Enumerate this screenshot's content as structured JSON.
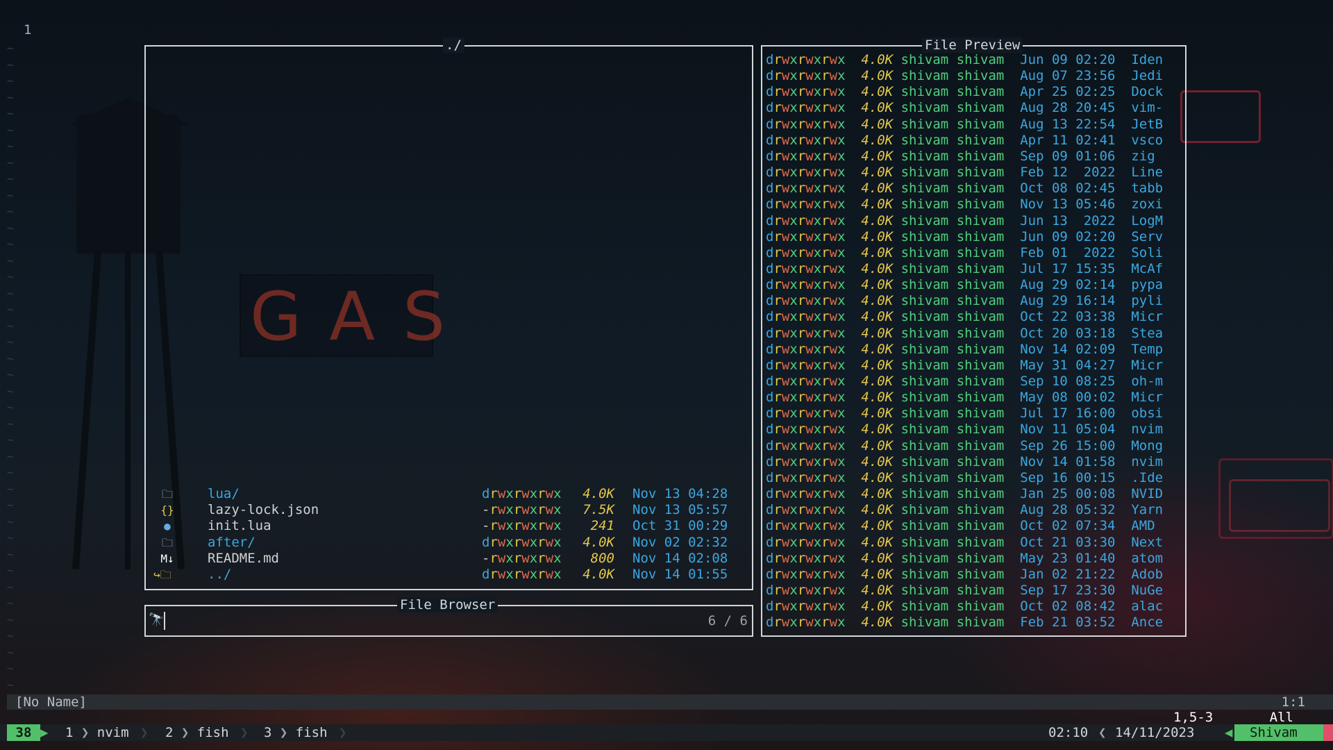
{
  "editor": {
    "line_number": "1",
    "buffer_name": "[No Name]",
    "cursor_pos": "1:1",
    "ruler_pos": "1,5-3",
    "ruler_scroll": "All"
  },
  "file_browser": {
    "path_title": "./",
    "title": "File Browser",
    "prompt_value": "",
    "count": "6 / 6",
    "entries": [
      {
        "icon": "folder-icon",
        "name": "lua/",
        "perm": "drwxrwxrwx",
        "size": "4.0K",
        "date": "Nov 13 04:28",
        "is_dir": true
      },
      {
        "icon": "json-icon",
        "name": "lazy-lock.json",
        "perm": "-rwxrwxrwx",
        "size": "7.5K",
        "date": "Nov 13 05:57",
        "is_dir": false
      },
      {
        "icon": "lua-icon",
        "name": "init.lua",
        "perm": "-rwxrwxrwx",
        "size": "241",
        "date": "Oct 31 00:29",
        "is_dir": false
      },
      {
        "icon": "folder-icon",
        "name": "after/",
        "perm": "drwxrwxrwx",
        "size": "4.0K",
        "date": "Nov 02 02:32",
        "is_dir": true
      },
      {
        "icon": "markdown-icon",
        "name": "README.md",
        "perm": "-rwxrwxrwx",
        "size": "800",
        "date": "Nov 14 02:08",
        "is_dir": false
      },
      {
        "icon": "parent-folder-icon",
        "name": "../",
        "perm": "drwxrwxrwx",
        "size": "4.0K",
        "date": "Nov 14 01:55",
        "is_dir": true
      }
    ]
  },
  "file_preview": {
    "title": "File Preview",
    "rows": [
      {
        "perm": "drwxrwxrwx",
        "size": "4.0K",
        "user": "shivam",
        "group": "shivam",
        "date": "Jun 09 02:20",
        "name": "Iden"
      },
      {
        "perm": "drwxrwxrwx",
        "size": "4.0K",
        "user": "shivam",
        "group": "shivam",
        "date": "Aug 07 23:56",
        "name": "Jedi"
      },
      {
        "perm": "drwxrwxrwx",
        "size": "4.0K",
        "user": "shivam",
        "group": "shivam",
        "date": "Apr 25 02:25",
        "name": "Dock"
      },
      {
        "perm": "drwxrwxrwx",
        "size": "4.0K",
        "user": "shivam",
        "group": "shivam",
        "date": "Aug 28 20:45",
        "name": "vim-"
      },
      {
        "perm": "drwxrwxrwx",
        "size": "4.0K",
        "user": "shivam",
        "group": "shivam",
        "date": "Aug 13 22:54",
        "name": "JetB"
      },
      {
        "perm": "drwxrwxrwx",
        "size": "4.0K",
        "user": "shivam",
        "group": "shivam",
        "date": "Apr 11 02:41",
        "name": "vsco"
      },
      {
        "perm": "drwxrwxrwx",
        "size": "4.0K",
        "user": "shivam",
        "group": "shivam",
        "date": "Sep 09 01:06",
        "name": "zig"
      },
      {
        "perm": "drwxrwxrwx",
        "size": "4.0K",
        "user": "shivam",
        "group": "shivam",
        "date": "Feb 12  2022",
        "name": "Line"
      },
      {
        "perm": "drwxrwxrwx",
        "size": "4.0K",
        "user": "shivam",
        "group": "shivam",
        "date": "Oct 08 02:45",
        "name": "tabb"
      },
      {
        "perm": "drwxrwxrwx",
        "size": "4.0K",
        "user": "shivam",
        "group": "shivam",
        "date": "Nov 13 05:46",
        "name": "zoxi"
      },
      {
        "perm": "drwxrwxrwx",
        "size": "4.0K",
        "user": "shivam",
        "group": "shivam",
        "date": "Jun 13  2022",
        "name": "LogM"
      },
      {
        "perm": "drwxrwxrwx",
        "size": "4.0K",
        "user": "shivam",
        "group": "shivam",
        "date": "Jun 09 02:20",
        "name": "Serv"
      },
      {
        "perm": "drwxrwxrwx",
        "size": "4.0K",
        "user": "shivam",
        "group": "shivam",
        "date": "Feb 01  2022",
        "name": "Soli"
      },
      {
        "perm": "drwxrwxrwx",
        "size": "4.0K",
        "user": "shivam",
        "group": "shivam",
        "date": "Jul 17 15:35",
        "name": "McAf"
      },
      {
        "perm": "drwxrwxrwx",
        "size": "4.0K",
        "user": "shivam",
        "group": "shivam",
        "date": "Aug 29 02:14",
        "name": "pypa"
      },
      {
        "perm": "drwxrwxrwx",
        "size": "4.0K",
        "user": "shivam",
        "group": "shivam",
        "date": "Aug 29 16:14",
        "name": "pyli"
      },
      {
        "perm": "drwxrwxrwx",
        "size": "4.0K",
        "user": "shivam",
        "group": "shivam",
        "date": "Oct 22 03:38",
        "name": "Micr"
      },
      {
        "perm": "drwxrwxrwx",
        "size": "4.0K",
        "user": "shivam",
        "group": "shivam",
        "date": "Oct 20 03:18",
        "name": "Stea"
      },
      {
        "perm": "drwxrwxrwx",
        "size": "4.0K",
        "user": "shivam",
        "group": "shivam",
        "date": "Nov 14 02:09",
        "name": "Temp"
      },
      {
        "perm": "drwxrwxrwx",
        "size": "4.0K",
        "user": "shivam",
        "group": "shivam",
        "date": "May 31 04:27",
        "name": "Micr"
      },
      {
        "perm": "drwxrwxrwx",
        "size": "4.0K",
        "user": "shivam",
        "group": "shivam",
        "date": "Sep 10 08:25",
        "name": "oh-m"
      },
      {
        "perm": "drwxrwxrwx",
        "size": "4.0K",
        "user": "shivam",
        "group": "shivam",
        "date": "May 08 00:02",
        "name": "Micr"
      },
      {
        "perm": "drwxrwxrwx",
        "size": "4.0K",
        "user": "shivam",
        "group": "shivam",
        "date": "Jul 17 16:00",
        "name": "obsi"
      },
      {
        "perm": "drwxrwxrwx",
        "size": "4.0K",
        "user": "shivam",
        "group": "shivam",
        "date": "Nov 11 05:04",
        "name": "nvim"
      },
      {
        "perm": "drwxrwxrwx",
        "size": "4.0K",
        "user": "shivam",
        "group": "shivam",
        "date": "Sep 26 15:00",
        "name": "Mong"
      },
      {
        "perm": "drwxrwxrwx",
        "size": "4.0K",
        "user": "shivam",
        "group": "shivam",
        "date": "Nov 14 01:58",
        "name": "nvim"
      },
      {
        "perm": "drwxrwxrwx",
        "size": "4.0K",
        "user": "shivam",
        "group": "shivam",
        "date": "Sep 16 00:15",
        "name": ".Ide"
      },
      {
        "perm": "drwxrwxrwx",
        "size": "4.0K",
        "user": "shivam",
        "group": "shivam",
        "date": "Jan 25 00:08",
        "name": "NVID"
      },
      {
        "perm": "drwxrwxrwx",
        "size": "4.0K",
        "user": "shivam",
        "group": "shivam",
        "date": "Aug 28 05:32",
        "name": "Yarn"
      },
      {
        "perm": "drwxrwxrwx",
        "size": "4.0K",
        "user": "shivam",
        "group": "shivam",
        "date": "Oct 02 07:34",
        "name": "AMD"
      },
      {
        "perm": "drwxrwxrwx",
        "size": "4.0K",
        "user": "shivam",
        "group": "shivam",
        "date": "Oct 21 03:30",
        "name": "Next"
      },
      {
        "perm": "drwxrwxrwx",
        "size": "4.0K",
        "user": "shivam",
        "group": "shivam",
        "date": "May 23 01:40",
        "name": "atom"
      },
      {
        "perm": "drwxrwxrwx",
        "size": "4.0K",
        "user": "shivam",
        "group": "shivam",
        "date": "Jan 02 21:22",
        "name": "Adob"
      },
      {
        "perm": "drwxrwxrwx",
        "size": "4.0K",
        "user": "shivam",
        "group": "shivam",
        "date": "Sep 17 23:30",
        "name": "NuGe"
      },
      {
        "perm": "drwxrwxrwx",
        "size": "4.0K",
        "user": "shivam",
        "group": "shivam",
        "date": "Oct 02 08:42",
        "name": "alac"
      },
      {
        "perm": "drwxrwxrwx",
        "size": "4.0K",
        "user": "shivam",
        "group": "shivam",
        "date": "Feb 21 03:52",
        "name": "Ance"
      }
    ]
  },
  "tmux": {
    "session": "38",
    "windows": [
      {
        "index": "1",
        "name": "nvim"
      },
      {
        "index": "2",
        "name": "fish"
      },
      {
        "index": "3",
        "name": "fish"
      }
    ],
    "time": "02:10",
    "date": "14/11/2023",
    "user": "Shivam"
  },
  "colors": {
    "accent_green": "#52c06a",
    "dir_blue": "#3ba7e0",
    "perm_yellow": "#e6c84a",
    "perm_orange": "#e26b4a"
  }
}
